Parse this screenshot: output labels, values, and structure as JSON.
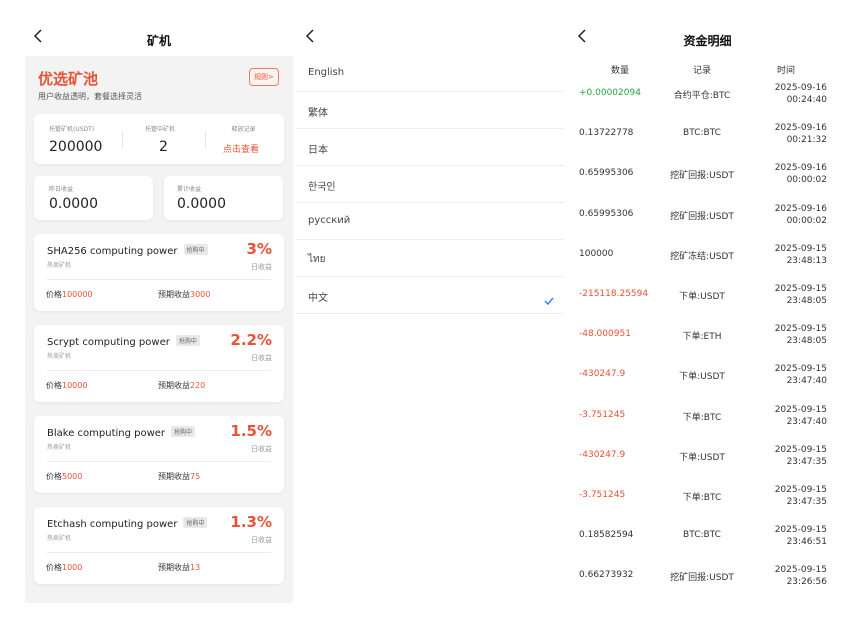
{
  "mining": {
    "title": "矿机",
    "header": {
      "title": "优选矿池",
      "subtitle": "用户收益透明，套餐选择灵活",
      "rules_label": "规则>"
    },
    "stats": [
      {
        "label": "托管矿机(USDT)",
        "value": "200000"
      },
      {
        "label": "托管中矿机",
        "value": "2"
      },
      {
        "label": "释放记录",
        "link": "点击查看"
      }
    ],
    "income": [
      {
        "label": "昨日收益",
        "value": "0.0000"
      },
      {
        "label": "累计收益",
        "value": "0.0000"
      }
    ],
    "machines": [
      {
        "name": "SHA256 computing power",
        "badge": "抢购中",
        "sub": "热卖矿机",
        "rate": "3%",
        "rate_label": "日收益",
        "price_label": "价格",
        "price": "100000",
        "profit_label": "预期收益",
        "profit": "3000"
      },
      {
        "name": "Scrypt computing power",
        "badge": "抢购中",
        "sub": "热卖矿机",
        "rate": "2.2%",
        "rate_label": "日收益",
        "price_label": "价格",
        "price": "10000",
        "profit_label": "预期收益",
        "profit": "220"
      },
      {
        "name": "Blake computing power",
        "badge": "抢购中",
        "sub": "热卖矿机",
        "rate": "1.5%",
        "rate_label": "日收益",
        "price_label": "价格",
        "price": "5000",
        "profit_label": "预期收益",
        "profit": "75"
      },
      {
        "name": "Etchash computing power",
        "badge": "抢购中",
        "sub": "热卖矿机",
        "rate": "1.3%",
        "rate_label": "日收益",
        "price_label": "价格",
        "price": "1000",
        "profit_label": "预期收益",
        "profit": "13"
      }
    ]
  },
  "languages": {
    "items": [
      "English",
      "繁体",
      "日本",
      "한국인",
      "русский",
      "ไทย",
      "中文"
    ],
    "selected": "中文",
    "accent": "#3b82f6"
  },
  "funds": {
    "title": "资金明细",
    "columns": [
      "数量",
      "记录",
      "时间"
    ],
    "rows": [
      {
        "amount": "+0.00002094",
        "type": "pos",
        "record": "合约平仓:BTC",
        "date": "2025-09-16",
        "time": "00:24:40"
      },
      {
        "amount": "0.13722778",
        "type": "neu",
        "record": "BTC:BTC",
        "date": "2025-09-16",
        "time": "00:21:32"
      },
      {
        "amount": "0.65995306",
        "type": "neu",
        "record": "挖矿回报:USDT",
        "date": "2025-09-16",
        "time": "00:00:02"
      },
      {
        "amount": "0.65995306",
        "type": "neu",
        "record": "挖矿回报:USDT",
        "date": "2025-09-16",
        "time": "00:00:02"
      },
      {
        "amount": "100000",
        "type": "neu",
        "record": "挖矿冻结:USDT",
        "date": "2025-09-15",
        "time": "23:48:13"
      },
      {
        "amount": "-215118.25594",
        "type": "neg",
        "record": "下单:USDT",
        "date": "2025-09-15",
        "time": "23:48:05"
      },
      {
        "amount": "-48.000951",
        "type": "neg",
        "record": "下单:ETH",
        "date": "2025-09-15",
        "time": "23:48:05"
      },
      {
        "amount": "-430247.9",
        "type": "neg",
        "record": "下单:USDT",
        "date": "2025-09-15",
        "time": "23:47:40"
      },
      {
        "amount": "-3.751245",
        "type": "neg",
        "record": "下单:BTC",
        "date": "2025-09-15",
        "time": "23:47:40"
      },
      {
        "amount": "-430247.9",
        "type": "neg",
        "record": "下单:USDT",
        "date": "2025-09-15",
        "time": "23:47:35"
      },
      {
        "amount": "-3.751245",
        "type": "neg",
        "record": "下单:BTC",
        "date": "2025-09-15",
        "time": "23:47:35"
      },
      {
        "amount": "0.18582594",
        "type": "neu",
        "record": "BTC:BTC",
        "date": "2025-09-15",
        "time": "23:46:51"
      },
      {
        "amount": "0.66273932",
        "type": "neu",
        "record": "挖矿回报:USDT",
        "date": "2025-09-15",
        "time": "23:26:56"
      }
    ]
  },
  "colors": {
    "accent_red": "#e65336",
    "positive_green": "#26a342"
  },
  "icons": {
    "back": "chevron-left-icon",
    "check": "check-icon"
  }
}
